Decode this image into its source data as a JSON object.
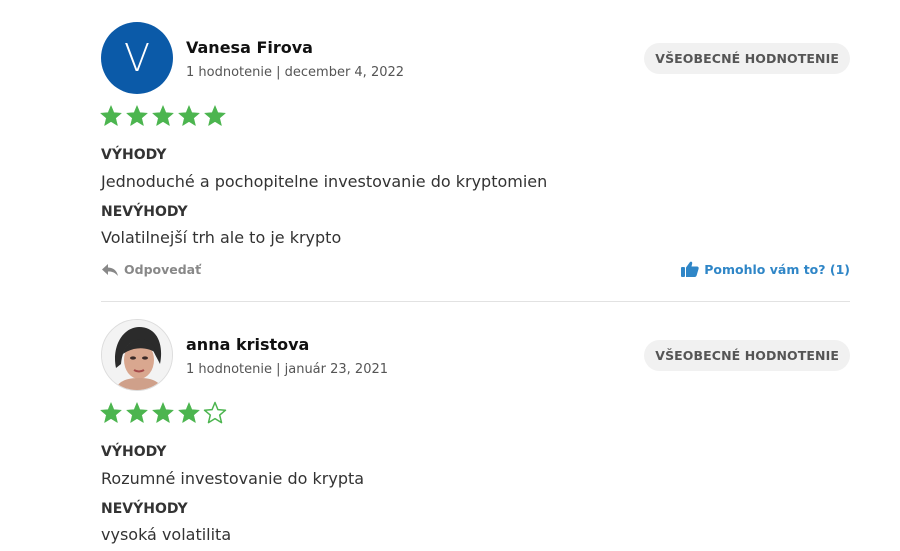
{
  "colors": {
    "star_filled": "#4cb54f",
    "avatar_bg": "#0b5aa8",
    "helpful_link": "#2f86c7",
    "badge_bg": "#f1f1f1"
  },
  "reviews": [
    {
      "avatar_letter": "V",
      "name": "Vanesa Firova",
      "meta": "1 hodnotenie | december 4, 2022",
      "badge": "VŠEOBECNÉ HODNOTENIE",
      "rating": 5,
      "rating_max": 5,
      "pros_label": "VÝHODY",
      "pros_text": "Jednoduché a pochopitelne investovanie do kryptomien",
      "cons_label": "NEVÝHODY",
      "cons_text": "Volatilnejší trh ale to je krypto",
      "reply_label": "Odpovedať",
      "helpful_label": "Pomohlo vám to? (1)"
    },
    {
      "avatar_icon": "user-photo",
      "name": "anna kristova",
      "meta": "1 hodnotenie | január 23, 2021",
      "badge": "VŠEOBECNÉ HODNOTENIE",
      "rating": 4,
      "rating_max": 5,
      "pros_label": "VÝHODY",
      "pros_text": "Rozumné investovanie do krypta",
      "cons_label": "NEVÝHODY",
      "cons_text": "vysoká volatilita"
    }
  ]
}
